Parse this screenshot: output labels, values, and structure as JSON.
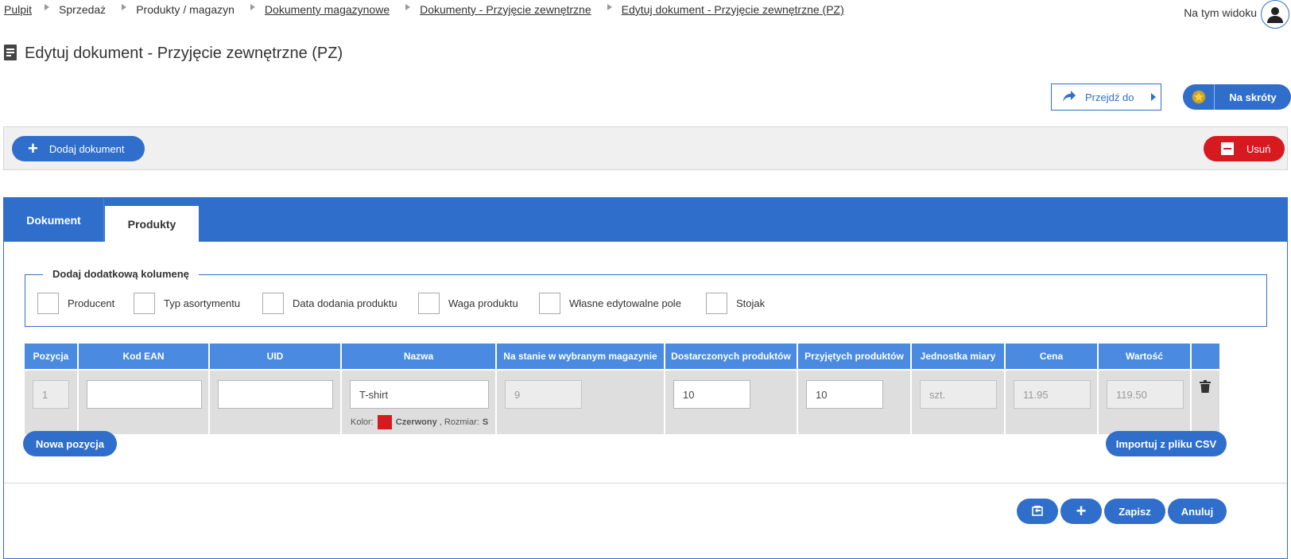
{
  "breadcrumb": {
    "items": [
      {
        "label": "Pulpit",
        "link": true
      },
      {
        "label": "Sprzedaż",
        "link": false
      },
      {
        "label": "Produkty / magazyn",
        "link": false
      },
      {
        "label": "Dokumenty magazynowe",
        "link": true
      },
      {
        "label": "Dokumenty - Przyjęcie zewnętrzne",
        "link": true
      },
      {
        "label": "Edytuj dokument - Przyjęcie zewnętrzne (PZ)",
        "link": true
      }
    ]
  },
  "header": {
    "view_label": "Na tym widoku",
    "title": "Edytuj dokument - Przyjęcie zewnętrzne (PZ)",
    "goto_label": "Przejdź do",
    "shortcuts_label": "Na skróty"
  },
  "toolbar": {
    "add_document_label": "Dodaj dokument",
    "delete_label": "Usuń"
  },
  "tabs": [
    {
      "label": "Dokument",
      "active": false
    },
    {
      "label": "Produkty",
      "active": true
    }
  ],
  "extra_columns": {
    "legend": "Dodaj dodatkową kolumenę",
    "options": [
      "Producent",
      "Typ asortymentu",
      "Data dodania produktu",
      "Waga produktu",
      "Własne edytowalne pole",
      "Stojak"
    ]
  },
  "table": {
    "headers": [
      "Pozycja",
      "Kod EAN",
      "UID",
      "Nazwa",
      "Na stanie w wybranym magazynie",
      "Dostarczonych produktów",
      "Przyjętych produktów",
      "Jednostka miary",
      "Cena",
      "Wartość",
      ""
    ],
    "rows": [
      {
        "position": "1",
        "ean": "",
        "uid": "",
        "name": "T-shirt",
        "variant_color_label": "Kolor:",
        "variant_color_value": "Czerwony",
        "variant_color_hex": "#d71920",
        "variant_size_label": ", Rozmiar:",
        "variant_size_value": "S",
        "in_stock": "9",
        "delivered": "10",
        "received": "10",
        "unit": "szt.",
        "price": "11.95",
        "value": "119.50"
      }
    ]
  },
  "actions": {
    "new_position_label": "Nowa pozycja",
    "import_csv_label": "Importuj z pliku CSV",
    "save_label": "Zapisz",
    "cancel_label": "Anuluj"
  },
  "colors": {
    "primary": "#2f6fcb",
    "table_header": "#4a8ae0",
    "danger": "#d71920"
  },
  "icons": [
    "document-icon",
    "user-icon",
    "share-arrow-icon",
    "star-icon",
    "plus-icon",
    "minus-icon",
    "trash-icon",
    "back-icon"
  ]
}
